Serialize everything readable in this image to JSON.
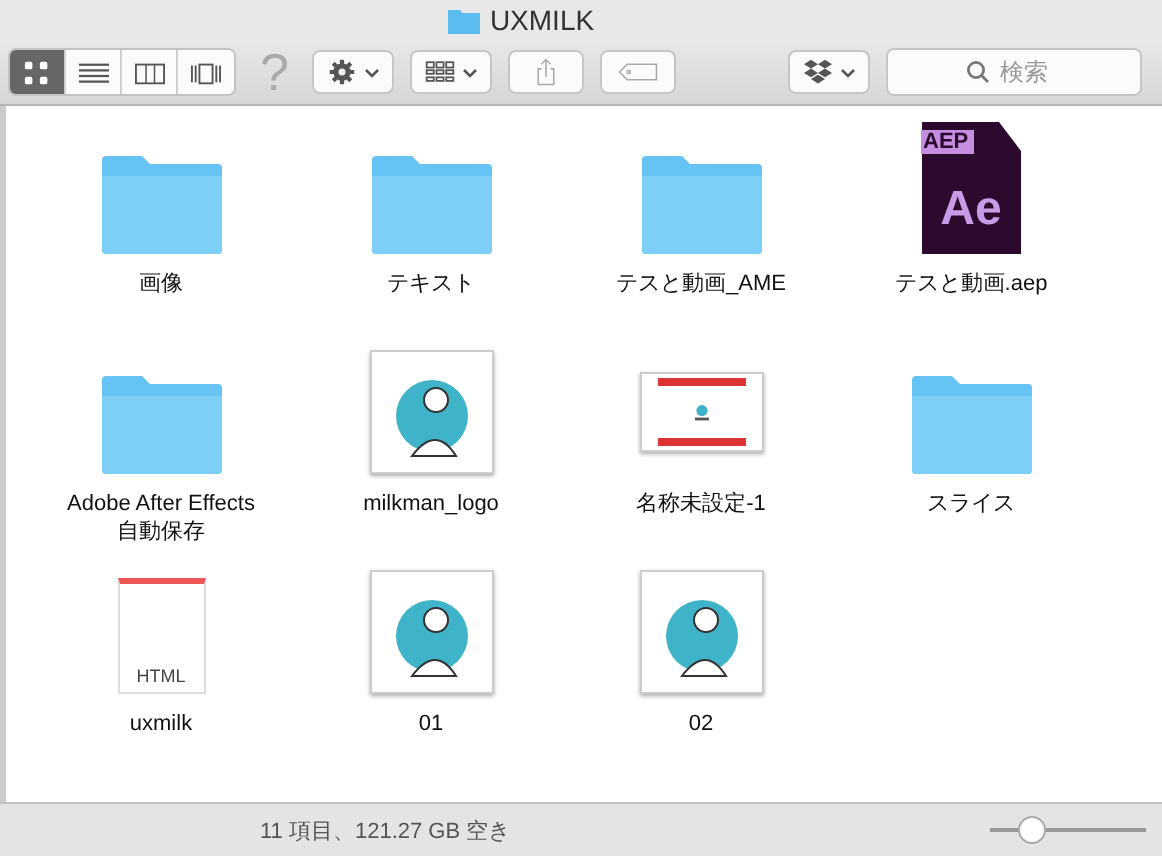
{
  "window": {
    "title": "UXMILK"
  },
  "toolbar": {
    "view_buttons": [
      {
        "kind": "icons",
        "selected": true
      },
      {
        "kind": "list",
        "selected": false
      },
      {
        "kind": "columns",
        "selected": false
      },
      {
        "kind": "coverflow",
        "selected": false
      }
    ],
    "help_glyph": "?",
    "search": {
      "placeholder": "検索"
    }
  },
  "items": [
    {
      "kind": "folder",
      "name": "画像"
    },
    {
      "kind": "folder",
      "name": "テキスト"
    },
    {
      "kind": "folder",
      "name": "テスと動画_AME"
    },
    {
      "kind": "aep",
      "name": "テスと動画.aep",
      "icon_texts": [
        "AEP",
        "Ae"
      ]
    },
    {
      "kind": "folder",
      "name": "Adobe After Effects 自動保存"
    },
    {
      "kind": "logo-image",
      "name": "milkman_logo"
    },
    {
      "kind": "banner-image",
      "name": "名称未設定-1"
    },
    {
      "kind": "folder",
      "name": "スライス"
    },
    {
      "kind": "html",
      "name": "uxmilk",
      "icon_texts": [
        "HTML"
      ]
    },
    {
      "kind": "logo-image",
      "name": "01"
    },
    {
      "kind": "logo-image",
      "name": "02"
    }
  ],
  "status_bar": {
    "text": "11 項目、121.27 GB 空き",
    "zoom_slider": {
      "level": 0.27
    }
  }
}
